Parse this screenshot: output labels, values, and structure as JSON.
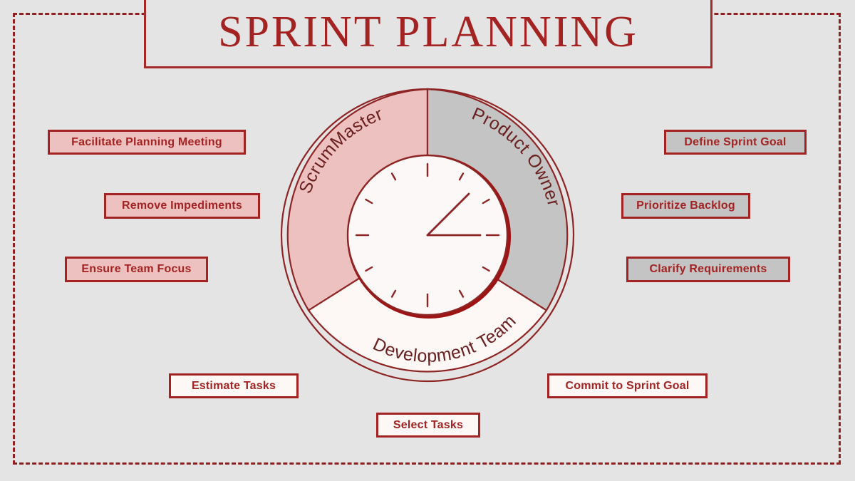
{
  "page": {
    "title": "SPRINT PLANNING",
    "background_color": "#e5e4e4",
    "accent_color": "#a32222",
    "pink_color": "#eec1c1",
    "gray_color": "#c4c4c4",
    "white_color": "#fdf7f5"
  },
  "wheel": {
    "segments": [
      {
        "name": "scrummaster",
        "label": "ScrumMaster",
        "color": "#eec1c1"
      },
      {
        "name": "product-owner",
        "label": "Product Owner",
        "color": "#c4c4c4"
      },
      {
        "name": "development-team",
        "label": "Development Team",
        "color": "#fdf7f5"
      }
    ],
    "clock": {
      "tick_count": 12,
      "hour_hand": "1",
      "minute_hand": "15"
    }
  },
  "callouts": {
    "left": [
      {
        "name": "facilitate-planning-meeting",
        "label": "Facilitate Planning Meeting",
        "style": "pink"
      },
      {
        "name": "remove-impediments",
        "label": "Remove Impediments",
        "style": "pink"
      },
      {
        "name": "ensure-team-focus",
        "label": "Ensure Team Focus",
        "style": "pink"
      }
    ],
    "right": [
      {
        "name": "define-sprint-goal",
        "label": "Define Sprint Goal",
        "style": "gray"
      },
      {
        "name": "prioritize-backlog",
        "label": "Prioritize Backlog",
        "style": "gray"
      },
      {
        "name": "clarify-requirements",
        "label": "Clarify Requirements",
        "style": "gray"
      }
    ],
    "bottom": [
      {
        "name": "estimate-tasks",
        "label": "Estimate Tasks",
        "style": "white"
      },
      {
        "name": "select-tasks",
        "label": "Select Tasks",
        "style": "white"
      },
      {
        "name": "commit-to-sprint-goal",
        "label": "Commit to Sprint Goal",
        "style": "white"
      }
    ]
  }
}
